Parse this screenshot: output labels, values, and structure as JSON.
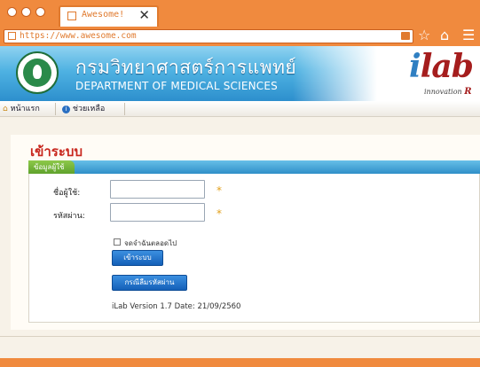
{
  "browser": {
    "tab_title": "Awesome!",
    "tab_close": "✕",
    "url": "https://www.awesome.com",
    "icons": [
      "star-icon",
      "home-icon",
      "menu-icon"
    ]
  },
  "banner": {
    "title_th": "กรมวิทยาศาสตร์การแพทย์",
    "title_en": "DEPARTMENT OF MEDICAL SCIENCES",
    "logo_text": "lab",
    "logo_i": "i",
    "logo_tagline": "innovation",
    "logo_tagline_r": "R"
  },
  "menubar": {
    "items": [
      {
        "label": "หน้าแรก",
        "icon": "home-icon"
      },
      {
        "label": "ช่วยเหลือ",
        "icon": "info-icon"
      }
    ]
  },
  "login": {
    "title": "เข้าระบบ",
    "section_label": "ข้อมูลผู้ใช้",
    "username_label": "ชื่อผู้ใช้:",
    "username_value": "",
    "password_label": "รหัสผ่าน:",
    "password_value": "",
    "required_mark": "*",
    "remember_label": "จดจำฉันตลอดไป",
    "remember_checked": false,
    "login_button": "เข้าระบบ",
    "forgot_button": "กรณีลืมรหัสผ่าน",
    "version_text": "iLab Version 1.7 Date: 21/09/2560"
  },
  "colors": {
    "browser_chrome": "#f08a3e",
    "background": "#5fa8a1",
    "title_red": "#c8271e",
    "button_blue": "#1460b8"
  }
}
